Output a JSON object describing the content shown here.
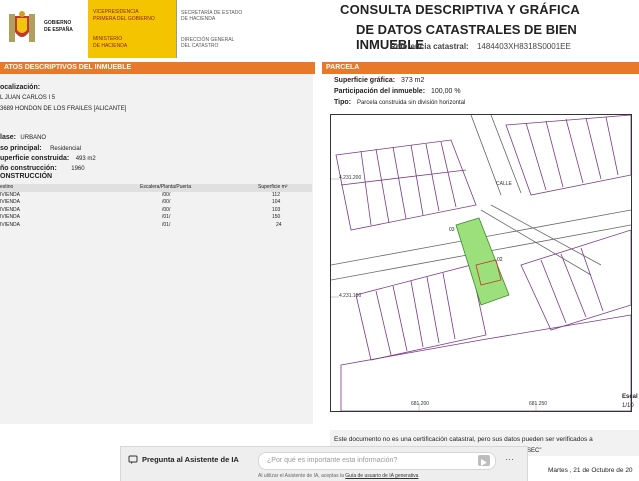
{
  "header": {
    "gov_line1": "GOBIERNO",
    "gov_line2": "DE ESPAÑA",
    "vp_line1": "VICEPRESIDENCIA",
    "vp_line2": "PRIMERA DEL GOBIERNO",
    "min_line1": "MINISTERIO",
    "min_line2": "DE HACIENDA",
    "sec_line1": "SECRETARÍA DE ESTADO",
    "sec_line2": "DE HACIENDA",
    "dir_line1": "DIRECCIÓN GENERAL",
    "dir_line2": "DEL CATASTRO",
    "title_line1": "CONSULTA DESCRIPTIVA Y GRÁFICA",
    "title_line2": "DE DATOS CATASTRALES DE BIEN INMUEBLE",
    "ref_label": "Referencia catastral:",
    "ref_value": "1484403XH8318S0001EE"
  },
  "left": {
    "section_title": "ATOS DESCRIPTIVOS DEL INMUEBLE",
    "loc_label": "ocalización:",
    "loc_line1": "L JUAN CARLOS I 5",
    "loc_line2": "3689 HONDON DE LOS FRAILES [ALICANTE]",
    "clase_label": "lase:",
    "clase_value": "URBANO",
    "uso_label": "so principal:",
    "uso_value": "Residencial",
    "sup_label": "uperficie construida:",
    "sup_value": "493 m2",
    "anio_label": "ño construcción:",
    "anio_value": "1960",
    "cons_title": "ONSTRUCCIÓN",
    "table_headers": [
      "estino",
      "Escalera/Planta/Puerta",
      "Superficie m²"
    ],
    "table_rows": [
      [
        "IVIENDA",
        "/00/",
        "112"
      ],
      [
        "IVIENDA",
        "/00/",
        "104"
      ],
      [
        "IVIENDA",
        "/00/",
        "103"
      ],
      [
        "IVIENDA",
        "/01/",
        "150"
      ],
      [
        "IVIENDA",
        "/01/",
        "24"
      ]
    ]
  },
  "right": {
    "section_title": "PARCELA",
    "sup_label": "Superficie gráfica:",
    "sup_value": "373 m2",
    "part_label": "Participación del inmueble:",
    "part_value": "100,00 %",
    "tipo_label": "Tipo:",
    "tipo_value": "Parcela construida sin división horizontal",
    "map_coord_y1": "4.231.200",
    "map_coord_y2": "4.231.150",
    "map_coord_x1": "681.200",
    "map_coord_x2": "681.250",
    "map_street1": "CALLE",
    "map_parcel_a": "03",
    "map_parcel_b": "02",
    "escala_label": "Escal",
    "escala_value": "1/10"
  },
  "footer": {
    "note": "Este documento no es una certificación catastral, pero sus datos pueden ser verificados a",
    "note2": "SEC\"",
    "date": "Martes , 21 de Octubre de 20"
  },
  "ai": {
    "label": "Pregunta al Asistente de IA",
    "placeholder": "¿Por qué es importante esta información?",
    "more": "···",
    "disclaimer_pre": "Al utilizar el Asistente de IA, aceptas la ",
    "disclaimer_link": "Guía de usuario de IA generativa"
  },
  "colors": {
    "accent": "#e8792a",
    "gov_yellow": "#f5c400",
    "parcel_green": "#9be07a"
  }
}
